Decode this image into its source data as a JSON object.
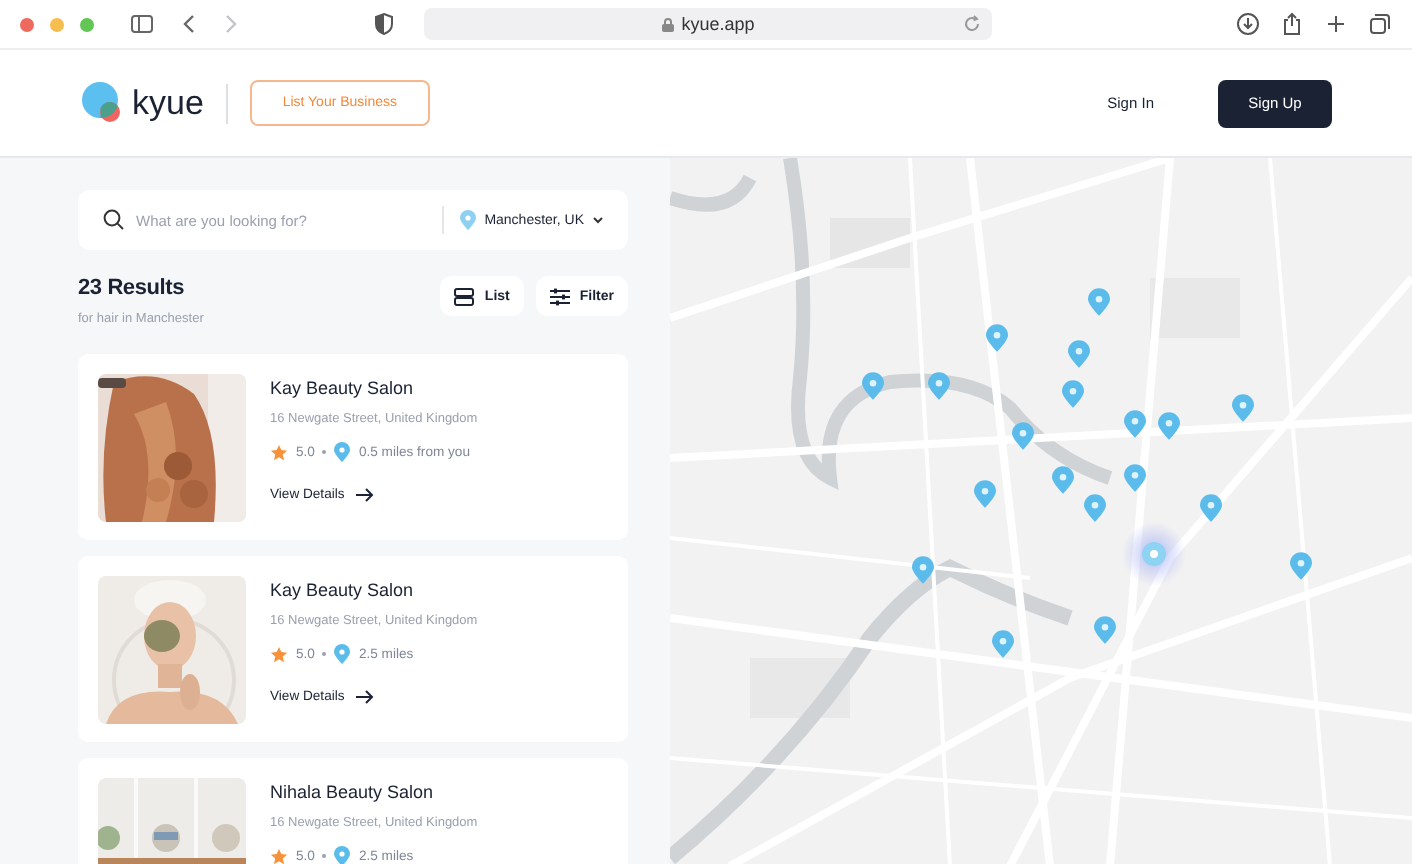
{
  "browser": {
    "url": "kyue.app",
    "back_disabled": false,
    "forward_disabled": true
  },
  "header": {
    "logo": "kyue",
    "list_business": "List Your Business",
    "sign_in": "Sign In",
    "sign_up": "Sign Up"
  },
  "search": {
    "placeholder": "What are you looking for?",
    "location": "Manchester, UK"
  },
  "results": {
    "title": "23 Results",
    "subtitle": "for hair in Manchester",
    "view_buttons": [
      {
        "kind": "list",
        "label": "List"
      },
      {
        "kind": "filter",
        "label": "Filter"
      }
    ]
  },
  "listings": [
    {
      "name": "Kay Beauty Salon",
      "address": "16 Newgate Street, United Kingdom",
      "rating": "5.0",
      "distance": "0.5 miles from you",
      "action": "View Details"
    },
    {
      "name": "Kay Beauty Salon",
      "address": "16 Newgate Street, United Kingdom",
      "rating": "5.0",
      "distance": "2.5 miles",
      "action": "View Details"
    },
    {
      "name": "Nihala Beauty Salon",
      "address": "16 Newgate Street, United Kingdom",
      "rating": "5.0",
      "distance": "2.5 miles"
    }
  ]
}
